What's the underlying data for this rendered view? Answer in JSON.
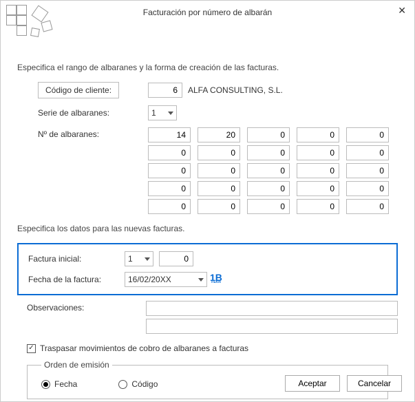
{
  "title": "Facturación por número de albarán",
  "section1_title": "Especifica el rango de albaranes y la forma de creación de las facturas.",
  "labels": {
    "codigo_cliente": "Código de cliente:",
    "serie_albaranes": "Serie de albaranes:",
    "num_albaranes": "Nº de albaranes:"
  },
  "cliente": {
    "codigo": "6",
    "nombre": "ALFA CONSULTING, S.L."
  },
  "serie_sel": "1",
  "albaranes_grid": [
    "14",
    "20",
    "0",
    "0",
    "0",
    "0",
    "0",
    "0",
    "0",
    "0",
    "0",
    "0",
    "0",
    "0",
    "0",
    "0",
    "0",
    "0",
    "0",
    "0",
    "0",
    "0",
    "0",
    "0",
    "0"
  ],
  "section2_title": "Especifica los datos para las nuevas facturas.",
  "blue": {
    "factura_inicial_label": "Factura inicial:",
    "factura_serie": "1",
    "factura_num": "0",
    "fecha_label": "Fecha de la factura:",
    "fecha_value": "16/02/20XX"
  },
  "obs_label": "Observaciones:",
  "obs_line1": "",
  "obs_line2": "",
  "check_label": "Traspasar movimientos de cobro de albaranes a facturas",
  "check_state": "✓",
  "orden": {
    "legend": "Orden de emisión",
    "opt_fecha": "Fecha",
    "opt_codigo": "Código"
  },
  "buttons": {
    "accept": "Aceptar",
    "cancel": "Cancelar"
  }
}
